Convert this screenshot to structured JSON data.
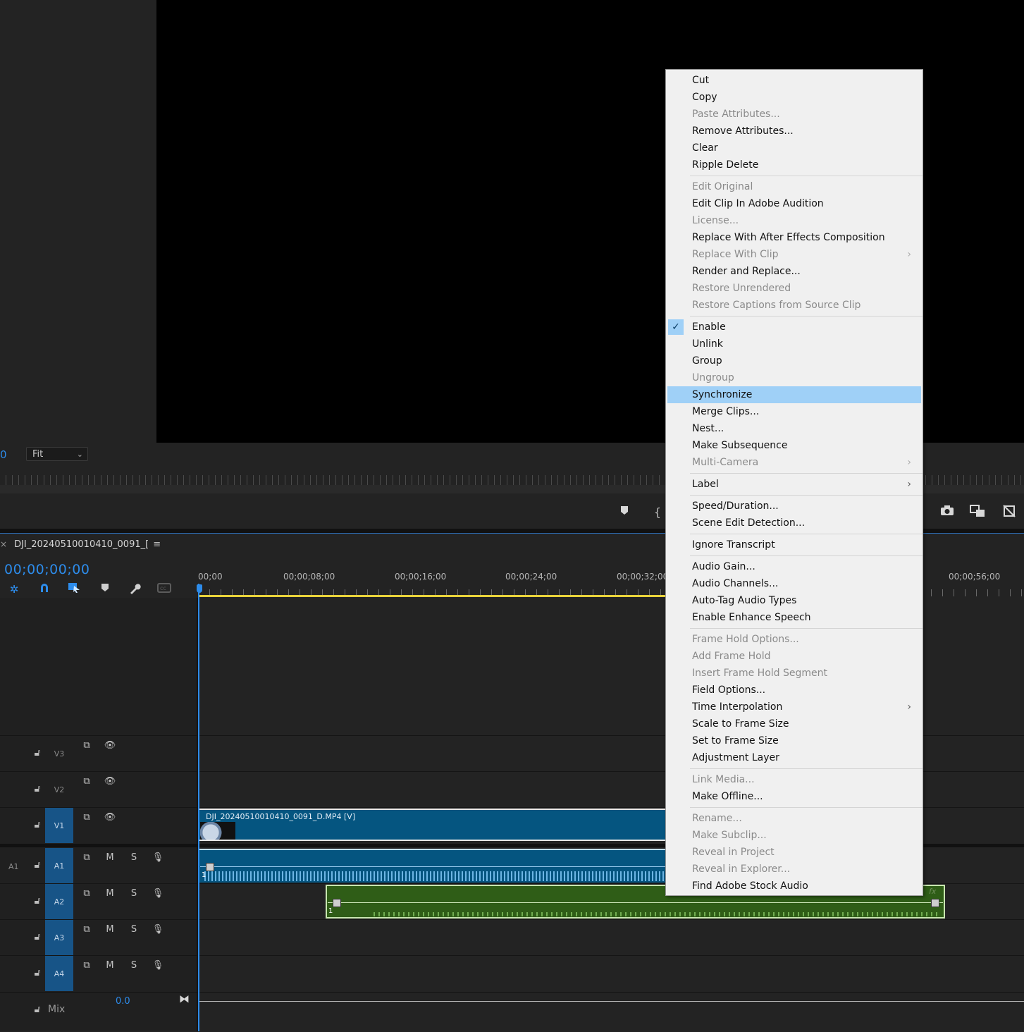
{
  "monitor": {
    "timecode_fragment": "0",
    "fit_label": "Fit"
  },
  "sequence": {
    "tab_title": "DJI_20240510010410_0091_[",
    "timecode": "00;00;00;00",
    "ruler_labels": [
      "00;00",
      "00;00;08;00",
      "00;00;16;00",
      "00;00;24;00",
      "00;00;32;00",
      "00;00;56;00"
    ]
  },
  "tracks": {
    "video": [
      {
        "name": "V3"
      },
      {
        "name": "V2"
      },
      {
        "name": "V1"
      }
    ],
    "audio": [
      {
        "name": "A1",
        "source": "A1"
      },
      {
        "name": "A2"
      },
      {
        "name": "A3"
      },
      {
        "name": "A4"
      }
    ],
    "mute_label": "M",
    "solo_label": "S",
    "mix_label": "Mix",
    "mix_value": "0.0"
  },
  "clips": {
    "v1_label": "DJI_20240510010410_0091_D.MP4 [V]",
    "a1_num": "1",
    "a2_num": "1",
    "a2_fx": "fx"
  },
  "context_menu": {
    "items": [
      {
        "label": "Cut",
        "enabled": true
      },
      {
        "label": "Copy",
        "enabled": true
      },
      {
        "label": "Paste Attributes...",
        "enabled": false
      },
      {
        "label": "Remove Attributes...",
        "enabled": true
      },
      {
        "label": "Clear",
        "enabled": true
      },
      {
        "label": "Ripple Delete",
        "enabled": true
      },
      {
        "label": "Edit Original",
        "enabled": false
      },
      {
        "label": "Edit Clip In Adobe Audition",
        "enabled": true
      },
      {
        "label": "License...",
        "enabled": false
      },
      {
        "label": "Replace With After Effects Composition",
        "enabled": true
      },
      {
        "label": "Replace With Clip",
        "enabled": false,
        "submenu": true
      },
      {
        "label": "Render and Replace...",
        "enabled": true
      },
      {
        "label": "Restore Unrendered",
        "enabled": false
      },
      {
        "label": "Restore Captions from Source Clip",
        "enabled": false
      },
      {
        "label": "Enable",
        "enabled": true,
        "checked": true
      },
      {
        "label": "Unlink",
        "enabled": true
      },
      {
        "label": "Group",
        "enabled": true
      },
      {
        "label": "Ungroup",
        "enabled": false
      },
      {
        "label": "Synchronize",
        "enabled": true,
        "highlighted": true
      },
      {
        "label": "Merge Clips...",
        "enabled": true
      },
      {
        "label": "Nest...",
        "enabled": true
      },
      {
        "label": "Make Subsequence",
        "enabled": true
      },
      {
        "label": "Multi-Camera",
        "enabled": false,
        "submenu": true
      },
      {
        "label": "Label",
        "enabled": true,
        "submenu": true
      },
      {
        "label": "Speed/Duration...",
        "enabled": true
      },
      {
        "label": "Scene Edit Detection...",
        "enabled": true
      },
      {
        "label": "Ignore Transcript",
        "enabled": true
      },
      {
        "label": "Audio Gain...",
        "enabled": true
      },
      {
        "label": "Audio Channels...",
        "enabled": true
      },
      {
        "label": "Auto-Tag Audio Types",
        "enabled": true
      },
      {
        "label": "Enable Enhance Speech",
        "enabled": true
      },
      {
        "label": "Frame Hold Options...",
        "enabled": false
      },
      {
        "label": "Add Frame Hold",
        "enabled": false
      },
      {
        "label": "Insert Frame Hold Segment",
        "enabled": false
      },
      {
        "label": "Field Options...",
        "enabled": true
      },
      {
        "label": "Time Interpolation",
        "enabled": true,
        "submenu": true
      },
      {
        "label": "Scale to Frame Size",
        "enabled": true
      },
      {
        "label": "Set to Frame Size",
        "enabled": true
      },
      {
        "label": "Adjustment Layer",
        "enabled": true
      },
      {
        "label": "Link Media...",
        "enabled": false
      },
      {
        "label": "Make Offline...",
        "enabled": true
      },
      {
        "label": "Rename...",
        "enabled": false
      },
      {
        "label": "Make Subclip...",
        "enabled": false
      },
      {
        "label": "Reveal in Project",
        "enabled": false
      },
      {
        "label": "Reveal in Explorer...",
        "enabled": false
      },
      {
        "label": "Find Adobe Stock Audio",
        "enabled": true
      }
    ],
    "checkmark": "✓",
    "submenu_arrow": "›"
  }
}
